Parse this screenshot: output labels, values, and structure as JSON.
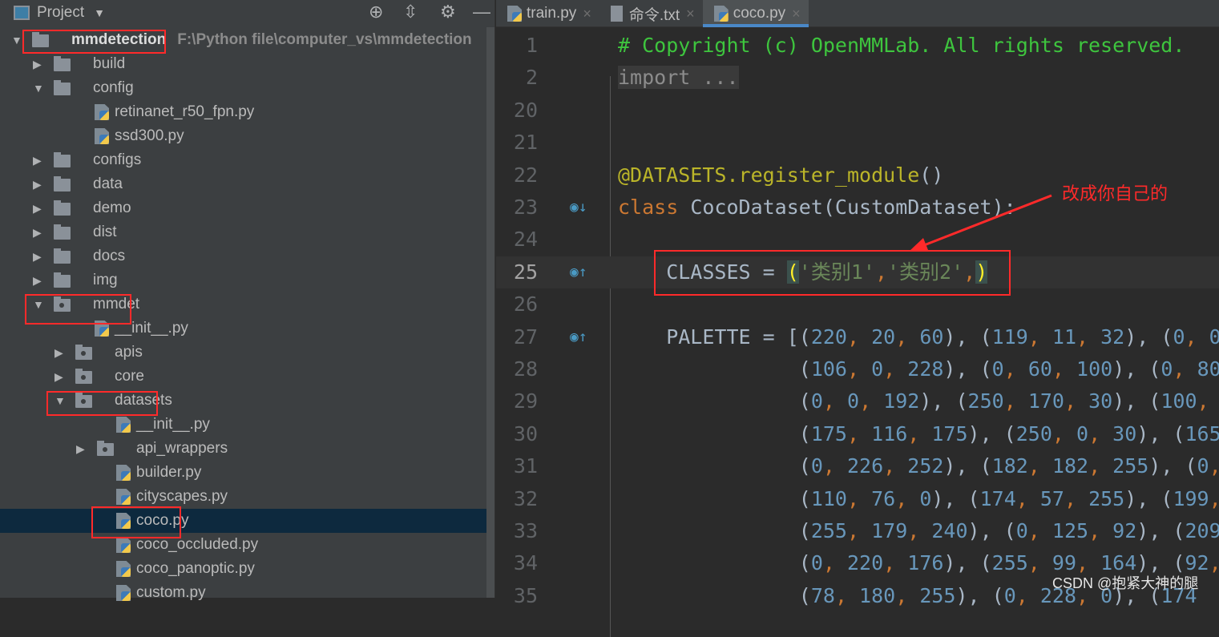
{
  "sidebar": {
    "title": "Project",
    "icons": [
      "locate-icon",
      "collapse-all-icon",
      "gear-icon",
      "minimize-icon"
    ],
    "tree": [
      {
        "label": "mmdetection",
        "path": "F:\\Python file\\computer_vs\\mmdetection",
        "level": 0,
        "type": "folder",
        "expanded": true,
        "bold": true
      },
      {
        "label": "build",
        "level": 1,
        "type": "folder",
        "expanded": false
      },
      {
        "label": "config",
        "level": 1,
        "type": "folder",
        "expanded": true
      },
      {
        "label": "retinanet_r50_fpn.py",
        "level": 2,
        "type": "py"
      },
      {
        "label": "ssd300.py",
        "level": 2,
        "type": "py"
      },
      {
        "label": "configs",
        "level": 1,
        "type": "folder",
        "expanded": false
      },
      {
        "label": "data",
        "level": 1,
        "type": "folder",
        "expanded": false
      },
      {
        "label": "demo",
        "level": 1,
        "type": "folder",
        "expanded": false
      },
      {
        "label": "dist",
        "level": 1,
        "type": "folder",
        "expanded": false
      },
      {
        "label": "docs",
        "level": 1,
        "type": "folder",
        "expanded": false
      },
      {
        "label": "img",
        "level": 1,
        "type": "folder",
        "expanded": false
      },
      {
        "label": "mmdet",
        "level": 1,
        "type": "pkg",
        "expanded": true
      },
      {
        "label": "__init__.py",
        "level": 2,
        "type": "py"
      },
      {
        "label": "apis",
        "level": 2,
        "type": "pkg",
        "expanded": false
      },
      {
        "label": "core",
        "level": 2,
        "type": "pkg",
        "expanded": false
      },
      {
        "label": "datasets",
        "level": 2,
        "type": "pkg",
        "expanded": true
      },
      {
        "label": "__init__.py",
        "level": 3,
        "type": "py"
      },
      {
        "label": "api_wrappers",
        "level": 3,
        "type": "pkg",
        "expanded": false
      },
      {
        "label": "builder.py",
        "level": 3,
        "type": "py"
      },
      {
        "label": "cityscapes.py",
        "level": 3,
        "type": "py"
      },
      {
        "label": "coco.py",
        "level": 3,
        "type": "py",
        "selected": true
      },
      {
        "label": "coco_occluded.py",
        "level": 3,
        "type": "py"
      },
      {
        "label": "coco_panoptic.py",
        "level": 3,
        "type": "py"
      },
      {
        "label": "custom.py",
        "level": 3,
        "type": "py"
      }
    ]
  },
  "tabs": [
    {
      "label": "train.py",
      "icon": "python-file-icon"
    },
    {
      "label": "命令.txt",
      "icon": "text-file-icon"
    },
    {
      "label": "coco.py",
      "icon": "python-file-icon",
      "active": true
    }
  ],
  "tab_close": "×",
  "editor": {
    "lines": [
      {
        "n": "1",
        "t": [
          [
            "# Copyright (c) OpenMMLab. All rights reserved.",
            "cm"
          ]
        ]
      },
      {
        "n": "2",
        "t": [
          [
            "import ...",
            "fold"
          ]
        ]
      },
      {
        "n": "20",
        "t": []
      },
      {
        "n": "21",
        "t": []
      },
      {
        "n": "22",
        "t": [
          [
            "@DATASETS.register_module",
            "dec"
          ],
          [
            "()",
            ""
          ]
        ]
      },
      {
        "n": "23",
        "g": "override-down-icon",
        "t": [
          [
            "class",
            "kw"
          ],
          [
            " CocoDataset(CustomDataset):",
            ""
          ]
        ]
      },
      {
        "n": "24",
        "t": []
      },
      {
        "n": "25",
        "g": "override-up-icon",
        "cur": true,
        "t": [
          [
            "    CLASSES = ",
            ""
          ],
          [
            "(",
            "br"
          ],
          [
            "'类别1'",
            "str"
          ],
          [
            ",",
            "op"
          ],
          [
            "'类别2'",
            "str"
          ],
          [
            ",",
            "op"
          ],
          [
            ")",
            "br"
          ]
        ]
      },
      {
        "n": "26",
        "t": []
      },
      {
        "n": "27",
        "g": "override-up-icon",
        "t": [
          [
            "    PALETTE = [(",
            ""
          ],
          [
            "220",
            "num"
          ],
          [
            ", ",
            "op"
          ],
          [
            "20",
            "num"
          ],
          [
            ", ",
            "op"
          ],
          [
            "60",
            "num"
          ],
          [
            "), (",
            ""
          ],
          [
            "119",
            "num"
          ],
          [
            ", ",
            "op"
          ],
          [
            "11",
            "num"
          ],
          [
            ", ",
            "op"
          ],
          [
            "32",
            "num"
          ],
          [
            "), (",
            ""
          ],
          [
            "0",
            "num"
          ],
          [
            ", ",
            "op"
          ],
          [
            "0",
            "num"
          ]
        ]
      },
      {
        "n": "28",
        "t": [
          [
            "               (",
            ""
          ],
          [
            "106",
            "num"
          ],
          [
            ", ",
            "op"
          ],
          [
            "0",
            "num"
          ],
          [
            ", ",
            "op"
          ],
          [
            "228",
            "num"
          ],
          [
            "), (",
            ""
          ],
          [
            "0",
            "num"
          ],
          [
            ", ",
            "op"
          ],
          [
            "60",
            "num"
          ],
          [
            ", ",
            "op"
          ],
          [
            "100",
            "num"
          ],
          [
            "), (",
            ""
          ],
          [
            "0",
            "num"
          ],
          [
            ", ",
            "op"
          ],
          [
            "80",
            "num"
          ]
        ]
      },
      {
        "n": "29",
        "t": [
          [
            "               (",
            ""
          ],
          [
            "0",
            "num"
          ],
          [
            ", ",
            "op"
          ],
          [
            "0",
            "num"
          ],
          [
            ", ",
            "op"
          ],
          [
            "192",
            "num"
          ],
          [
            "), (",
            ""
          ],
          [
            "250",
            "num"
          ],
          [
            ", ",
            "op"
          ],
          [
            "170",
            "num"
          ],
          [
            ", ",
            "op"
          ],
          [
            "30",
            "num"
          ],
          [
            "), (",
            ""
          ],
          [
            "100",
            "num"
          ],
          [
            ",",
            "op"
          ]
        ]
      },
      {
        "n": "30",
        "t": [
          [
            "               (",
            ""
          ],
          [
            "175",
            "num"
          ],
          [
            ", ",
            "op"
          ],
          [
            "116",
            "num"
          ],
          [
            ", ",
            "op"
          ],
          [
            "175",
            "num"
          ],
          [
            "), (",
            ""
          ],
          [
            "250",
            "num"
          ],
          [
            ", ",
            "op"
          ],
          [
            "0",
            "num"
          ],
          [
            ", ",
            "op"
          ],
          [
            "30",
            "num"
          ],
          [
            "), (",
            ""
          ],
          [
            "165",
            "num"
          ]
        ]
      },
      {
        "n": "31",
        "t": [
          [
            "               (",
            ""
          ],
          [
            "0",
            "num"
          ],
          [
            ", ",
            "op"
          ],
          [
            "226",
            "num"
          ],
          [
            ", ",
            "op"
          ],
          [
            "252",
            "num"
          ],
          [
            "), (",
            ""
          ],
          [
            "182",
            "num"
          ],
          [
            ", ",
            "op"
          ],
          [
            "182",
            "num"
          ],
          [
            ", ",
            "op"
          ],
          [
            "255",
            "num"
          ],
          [
            "), (",
            ""
          ],
          [
            "0",
            "num"
          ],
          [
            ",",
            "op"
          ]
        ]
      },
      {
        "n": "32",
        "t": [
          [
            "               (",
            ""
          ],
          [
            "110",
            "num"
          ],
          [
            ", ",
            "op"
          ],
          [
            "76",
            "num"
          ],
          [
            ", ",
            "op"
          ],
          [
            "0",
            "num"
          ],
          [
            "), (",
            ""
          ],
          [
            "174",
            "num"
          ],
          [
            ", ",
            "op"
          ],
          [
            "57",
            "num"
          ],
          [
            ", ",
            "op"
          ],
          [
            "255",
            "num"
          ],
          [
            "), (",
            ""
          ],
          [
            "199",
            "num"
          ],
          [
            ",",
            "op"
          ]
        ]
      },
      {
        "n": "33",
        "t": [
          [
            "               (",
            ""
          ],
          [
            "255",
            "num"
          ],
          [
            ", ",
            "op"
          ],
          [
            "179",
            "num"
          ],
          [
            ", ",
            "op"
          ],
          [
            "240",
            "num"
          ],
          [
            "), (",
            ""
          ],
          [
            "0",
            "num"
          ],
          [
            ", ",
            "op"
          ],
          [
            "125",
            "num"
          ],
          [
            ", ",
            "op"
          ],
          [
            "92",
            "num"
          ],
          [
            "), (",
            ""
          ],
          [
            "209",
            "num"
          ]
        ]
      },
      {
        "n": "34",
        "t": [
          [
            "               (",
            ""
          ],
          [
            "0",
            "num"
          ],
          [
            ", ",
            "op"
          ],
          [
            "220",
            "num"
          ],
          [
            ", ",
            "op"
          ],
          [
            "176",
            "num"
          ],
          [
            "), (",
            ""
          ],
          [
            "255",
            "num"
          ],
          [
            ", ",
            "op"
          ],
          [
            "99",
            "num"
          ],
          [
            ", ",
            "op"
          ],
          [
            "164",
            "num"
          ],
          [
            "), (",
            ""
          ],
          [
            "92",
            "num"
          ],
          [
            ",",
            "op"
          ]
        ]
      },
      {
        "n": "35",
        "t": [
          [
            "               (",
            ""
          ],
          [
            "78",
            "num"
          ],
          [
            ", ",
            "op"
          ],
          [
            "180",
            "num"
          ],
          [
            ", ",
            "op"
          ],
          [
            "255",
            "num"
          ],
          [
            "), (",
            ""
          ],
          [
            "0",
            "num"
          ],
          [
            ", ",
            "op"
          ],
          [
            "228",
            "num"
          ],
          [
            ", ",
            "op"
          ],
          [
            "0",
            "num"
          ],
          [
            "), (",
            ""
          ],
          [
            "174",
            "num"
          ]
        ]
      }
    ]
  },
  "annotation": {
    "note": "改成你自己的",
    "color": "#ff2a2a"
  },
  "watermark": "CSDN @抱紧大神的腿"
}
